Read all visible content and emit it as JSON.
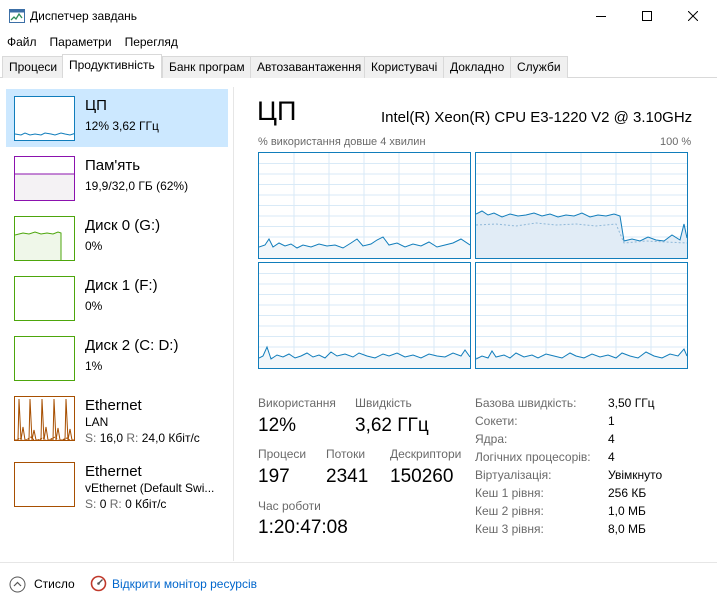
{
  "window": {
    "title": "Диспетчер завдань"
  },
  "menu": [
    "Файл",
    "Параметри",
    "Перегляд"
  ],
  "tabs": [
    "Процеси",
    "Продуктивність",
    "Банк програм",
    "Автозавантаження",
    "Користувачі",
    "Докладно",
    "Служби"
  ],
  "active_tab": "Продуктивність",
  "sidebar": {
    "cpu": {
      "title": "ЦП",
      "sub": "12% 3,62 ГГц",
      "color": "#117dbb"
    },
    "memory": {
      "title": "Пам'ять",
      "sub": "19,9/32,0 ГБ (62%)",
      "color": "#8b12ae"
    },
    "disk0": {
      "title": "Диск 0 (G:)",
      "sub": "0%",
      "color": "#4da60c"
    },
    "disk1": {
      "title": "Диск 1 (F:)",
      "sub": "0%",
      "color": "#4da60c"
    },
    "disk2": {
      "title": "Диск 2 (C: D:)",
      "sub": "1%",
      "color": "#4da60c"
    },
    "eth1": {
      "title": "Ethernet",
      "line1": "LAN",
      "s_label": "S:",
      "s_value": "16,0",
      "r_label": "R:",
      "r_value": "24,0 Кбіт/с",
      "color": "#a74f01"
    },
    "eth2": {
      "title": "Ethernet",
      "line1": "vEthernet (Default Swi...",
      "s_label": "S:",
      "s_value": "0",
      "r_label": "R:",
      "r_value": "0 Кбіт/с",
      "color": "#a74f01"
    }
  },
  "panel": {
    "heading": "ЦП",
    "model": "Intel(R) Xeon(R) CPU E3-1220 V2 @ 3.10GHz",
    "graph_caption": "% використання довше 4 хвилин",
    "graph_max": "100 %",
    "usage_label": "Використання",
    "usage_value": "12%",
    "speed_label": "Швидкість",
    "speed_value": "3,62 ГГц",
    "processes_label": "Процеси",
    "processes_value": "197",
    "threads_label": "Потоки",
    "threads_value": "2341",
    "handles_label": "Дескриптори",
    "handles_value": "150260",
    "uptime_label": "Час роботи",
    "uptime_value": "1:20:47:08",
    "info": [
      {
        "label": "Базова швидкість:",
        "value": "3,50 ГГц"
      },
      {
        "label": "Сокети:",
        "value": "1"
      },
      {
        "label": "Ядра:",
        "value": "4"
      },
      {
        "label": "Логічних процесорів:",
        "value": "4"
      },
      {
        "label": "Віртуалізація:",
        "value": "Увімкнуто"
      },
      {
        "label": "Кеш 1 рівня:",
        "value": "256 КБ"
      },
      {
        "label": "Кеш 2 рівня:",
        "value": "1,0 МБ"
      },
      {
        "label": "Кеш 3 рівня:",
        "value": "8,0 МБ"
      }
    ]
  },
  "footer": {
    "fewer_details": "Стисло",
    "monitor_link": "Відкрити монітор ресурсів"
  }
}
